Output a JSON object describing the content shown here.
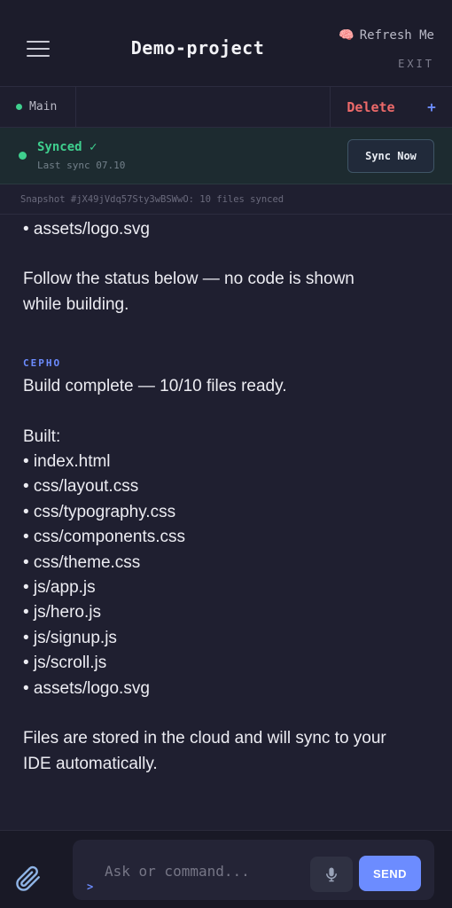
{
  "header": {
    "title": "Demo-project",
    "refresh_label": "Refresh Me",
    "exit_label": "EXIT"
  },
  "tabs": {
    "main_label": "Main",
    "delete_label": "Delete",
    "add_label": "+"
  },
  "sync": {
    "status": "Synced ✓",
    "last_sync": "Last sync 07.10",
    "button_label": "Sync Now"
  },
  "snapshot": "Snapshot #jX49jVdq57Sty3wBSWwO: 10 files synced",
  "chat": {
    "prev_tail": "• assets/logo.svg",
    "prev_note_1": "Follow the status below — no code is shown",
    "prev_note_2": "while building.",
    "sender": "CEPHO",
    "summary": "Build complete — 10/10 files ready.",
    "built_label": "Built:",
    "files": [
      "• index.html",
      "• css/layout.css",
      "• css/typography.css",
      "• css/components.css",
      "• css/theme.css",
      "• js/app.js",
      "• js/hero.js",
      "• js/signup.js",
      "• js/scroll.js",
      "• assets/logo.svg"
    ],
    "footer_1": "Files are stored in the cloud and will sync to your",
    "footer_2": "IDE automatically."
  },
  "composer": {
    "placeholder": "Ask or command...",
    "prompt_symbol": ">",
    "send_label": "SEND"
  },
  "colors": {
    "accent": "#6c8cff",
    "success": "#3fcf8e",
    "danger": "#ee6a6a",
    "background": "#1f1f30"
  },
  "icons": {
    "menu": "hamburger-icon",
    "refresh": "brain-icon",
    "attach": "paperclip-icon",
    "mic": "microphone-icon"
  }
}
